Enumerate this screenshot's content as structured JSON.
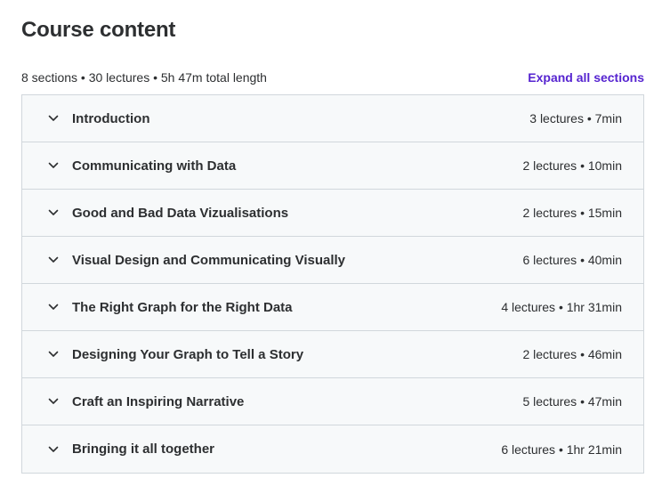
{
  "header": {
    "title": "Course content",
    "summary": "8 sections • 30 lectures • 5h 47m total length",
    "expand_all_label": "Expand all sections"
  },
  "icons": {
    "section_toggle": "chevron-down-icon"
  },
  "colors": {
    "accent": "#5624d0",
    "section_bg": "#f7f9fa",
    "border": "#d1d7dc",
    "text": "#2d2f31"
  },
  "sections": [
    {
      "title": "Introduction",
      "meta": "3 lectures • 7min"
    },
    {
      "title": "Communicating with Data",
      "meta": "2 lectures • 10min"
    },
    {
      "title": "Good and Bad Data Vizualisations",
      "meta": "2 lectures • 15min"
    },
    {
      "title": "Visual Design and Communicating Visually",
      "meta": "6 lectures • 40min"
    },
    {
      "title": "The Right Graph for the Right Data",
      "meta": "4 lectures • 1hr 31min"
    },
    {
      "title": "Designing Your Graph to Tell a Story",
      "meta": "2 lectures • 46min"
    },
    {
      "title": "Craft an Inspiring Narrative",
      "meta": "5 lectures • 47min"
    },
    {
      "title": "Bringing it all together",
      "meta": "6 lectures • 1hr 21min"
    }
  ]
}
